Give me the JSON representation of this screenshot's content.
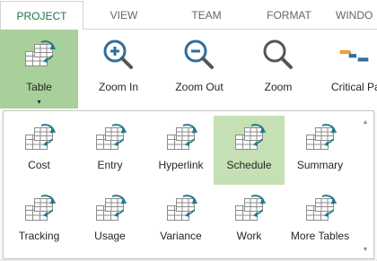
{
  "tabs": [
    {
      "label": "PROJECT",
      "active": true
    },
    {
      "label": "VIEW",
      "active": false
    },
    {
      "label": "TEAM",
      "active": false
    },
    {
      "label": "FORMAT",
      "active": false
    },
    {
      "label": "WINDO",
      "active": false
    }
  ],
  "ribbon": {
    "table_label": "Table",
    "table_caret": "▾",
    "zoom_in_label": "Zoom In",
    "zoom_out_label": "Zoom Out",
    "zoom_label": "Zoom",
    "critical_path_label": "Critical Pa"
  },
  "gallery": {
    "row1": [
      "Cost",
      "Entry",
      "Hyperlink",
      "Schedule",
      "Summary"
    ],
    "row2": [
      "Tracking",
      "Usage",
      "Variance",
      "Work",
      "More Tables"
    ],
    "highlighted": "Schedule",
    "scroll_up": "▲",
    "scroll_down": "▼"
  },
  "colors": {
    "accent_green": "#217346",
    "selected_button": "#a9cf9a",
    "hover_tile": "#c5e0b4",
    "icon_blue": "#2e6e9e",
    "icon_teal": "#1f7a8c",
    "critical_orange": "#f0a030"
  },
  "icons": {
    "table": "table-refresh-icon",
    "zoom_in": "zoom-in-icon",
    "zoom_out": "zoom-out-icon",
    "zoom": "magnifier-icon",
    "critical_path": "critical-path-icon"
  }
}
